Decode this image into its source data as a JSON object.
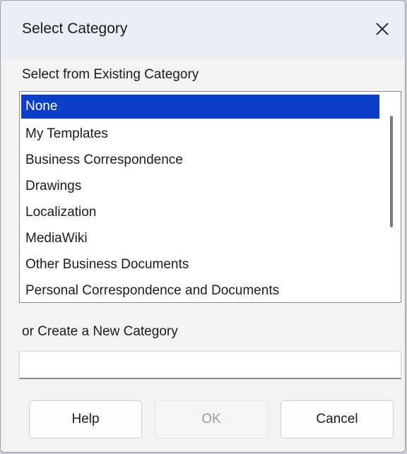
{
  "dialog": {
    "title": "Select Category",
    "close_icon": "close-icon"
  },
  "existing": {
    "label": "Select from Existing Category",
    "items": [
      {
        "label": "None",
        "selected": true
      },
      {
        "label": "My Templates",
        "selected": false
      },
      {
        "label": "Business Correspondence",
        "selected": false
      },
      {
        "label": "Drawings",
        "selected": false
      },
      {
        "label": "Localization",
        "selected": false
      },
      {
        "label": "MediaWiki",
        "selected": false
      },
      {
        "label": "Other Business Documents",
        "selected": false
      },
      {
        "label": "Personal Correspondence and Documents",
        "selected": false
      }
    ]
  },
  "new_category": {
    "label": "or Create a New Category",
    "value": "",
    "placeholder": ""
  },
  "buttons": {
    "help": "Help",
    "ok": "OK",
    "cancel": "Cancel"
  },
  "colors": {
    "selection": "#0b3fc7",
    "titlebar": "#e9eef4",
    "dialog_bg": "#f3f3f3"
  }
}
